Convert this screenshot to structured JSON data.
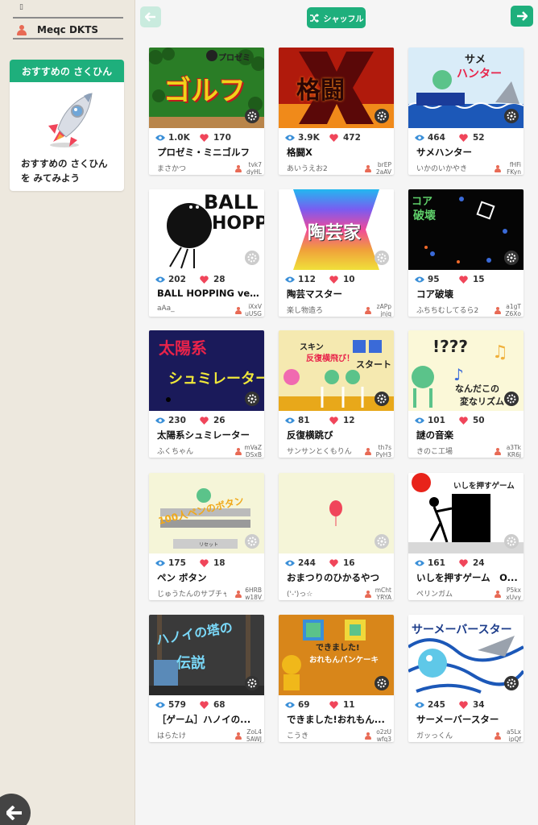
{
  "sidebar": {
    "small_glyph": "▯",
    "user_name": "Meqc DKTS",
    "recommend": {
      "header": "おすすめの さくひん",
      "line1": "おすすめの さくひん",
      "line2": "を みてみよう"
    }
  },
  "topbar": {
    "shuffle_label": "シャッフル"
  },
  "colors": {
    "accent": "#1eaf7c",
    "heart": "#f0455a",
    "eye": "#3a8fd8",
    "sidebar_bg": "#ede8de"
  },
  "cards": [
    {
      "views": "1.0K",
      "likes": "170",
      "title": "プロゼミ・ミニゴルフ",
      "author": "まさかつ",
      "code1": "tvk7",
      "code2": "dyHL",
      "thumb_text": "ゴルフ",
      "thumb_sub": "プロゼミ"
    },
    {
      "views": "3.9K",
      "likes": "472",
      "title": "格闘X",
      "author": "あいうえお2",
      "code1": "brEP",
      "code2": "2aAV",
      "thumb_text": "格闘",
      "thumb_sub": "X"
    },
    {
      "views": "464",
      "likes": "52",
      "title": "サメハンター",
      "author": "いかのいかやき",
      "code1": "fHFi",
      "code2": "FKyn",
      "thumb_text": "ハンター",
      "thumb_sub": "サメ"
    },
    {
      "views": "202",
      "likes": "28",
      "title": "BALL HOPPING ver...",
      "author": "aAa_",
      "code1": "iXxV",
      "code2": "uUSG",
      "thumb_text": "HOPPIN",
      "thumb_sub": "BALL"
    },
    {
      "views": "112",
      "likes": "10",
      "title": "陶芸マスター",
      "author": "楽し物造ろ",
      "code1": "zAPp",
      "code2": "jnjq",
      "thumb_text": "陶芸家",
      "thumb_sub": ""
    },
    {
      "views": "95",
      "likes": "15",
      "title": "コア破壊",
      "author": "ふちちむしてるら2",
      "code1": "a1gT",
      "code2": "Z6Xo",
      "thumb_text": "破壊",
      "thumb_sub": "コア"
    },
    {
      "views": "230",
      "likes": "26",
      "title": "太陽系シュミレーター",
      "author": "ふくちゃん",
      "code1": "mVaZ",
      "code2": "DSxB",
      "thumb_text": "シュミレーター",
      "thumb_sub": "太陽系"
    },
    {
      "views": "81",
      "likes": "12",
      "title": "反復横跳び",
      "author": "サンサンとくもりん",
      "code1": "th7s",
      "code2": "PyH3",
      "thumb_text": "反復横飛び！",
      "thumb_sub": "スキン",
      "thumb_extra": "スタート"
    },
    {
      "views": "101",
      "likes": "50",
      "title": "謎の音楽",
      "author": "きのこ工場",
      "code1": "a3Tk",
      "code2": "KR6j",
      "thumb_text": "なんだこの",
      "thumb_sub": "!???",
      "thumb_extra": "変なリズム"
    },
    {
      "views": "175",
      "likes": "18",
      "title": "ペン ボタン",
      "author": "じゅうたんのサブチャン",
      "code1": "6HRB",
      "code2": "w18V",
      "thumb_text": "100人ペンのボタン",
      "thumb_sub": "リセット"
    },
    {
      "views": "244",
      "likes": "16",
      "title": "おまつりのひかるやつ",
      "author": "('-')っ☆",
      "code1": "mCht",
      "code2": "YRYA",
      "thumb_text": "",
      "thumb_sub": ""
    },
    {
      "views": "161",
      "likes": "24",
      "title": "いしを押すゲーム　O...",
      "author": "ペリンガム",
      "code1": "P5kx",
      "code2": "xUvy",
      "thumb_text": "いしを押すゲーム",
      "thumb_sub": ""
    },
    {
      "views": "579",
      "likes": "68",
      "title": "［ゲーム］ハノイの...",
      "author": "はらたけ",
      "code1": "ZoL4",
      "code2": "5AWJ",
      "thumb_text": "ハノイの塔の",
      "thumb_sub": "伝説"
    },
    {
      "views": "69",
      "likes": "11",
      "title": "できました!おれもん...",
      "author": "こうき",
      "code1": "o2zU",
      "code2": "wfq3",
      "thumb_text": "おれもんパンケーキ",
      "thumb_sub": "できました!"
    },
    {
      "views": "245",
      "likes": "34",
      "title": "サーメーバースター",
      "author": "ガッっくん",
      "code1": "a5Lx",
      "code2": "ipQf",
      "thumb_text": "サーメーバースター",
      "thumb_sub": ""
    }
  ]
}
